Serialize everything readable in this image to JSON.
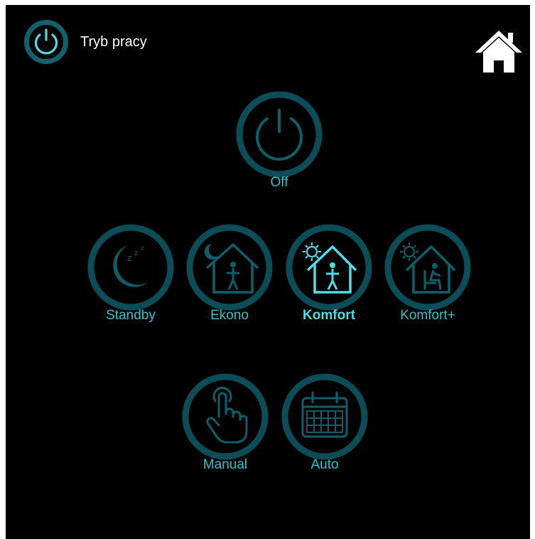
{
  "header": {
    "title": "Tryb pracy",
    "icon": "power-icon"
  },
  "home": {
    "icon": "home-icon"
  },
  "modes": {
    "off": {
      "label": "Off",
      "icon": "power-icon"
    },
    "standby": {
      "label": "Standby",
      "icon": "moon-sleep-icon"
    },
    "ekono": {
      "label": "Ekono",
      "icon": "house-moon-person-icon"
    },
    "komfort": {
      "label": "Komfort",
      "icon": "house-sun-person-icon",
      "active": true
    },
    "komfort_plus": {
      "label": "Komfort+",
      "icon": "house-sun-seated-icon"
    },
    "manual": {
      "label": "Manual",
      "icon": "hand-touch-icon"
    },
    "auto": {
      "label": "Auto",
      "icon": "calendar-icon"
    }
  },
  "colors": {
    "background": "#000000",
    "ring": "#0d4d57",
    "icon_dim": "#0f5f6b",
    "icon_active": "#4fdce6",
    "label": "#2fc4cf",
    "header_ring": "#14606c",
    "header_icon": "#4fdce6"
  }
}
